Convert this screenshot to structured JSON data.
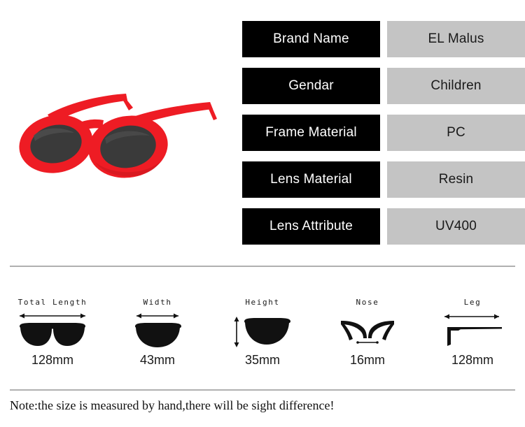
{
  "product": {
    "image_name": "red-oval-sunglasses",
    "frame_color": "#ee1c24",
    "frame_shadow_color": "#b3141a",
    "lens_color": "#3a3a3a",
    "lens_highlight_color": "#4e4e4e"
  },
  "spec_table": {
    "rows": [
      {
        "label": "Brand Name",
        "value": "EL Malus"
      },
      {
        "label": "Gendar",
        "value": "Children"
      },
      {
        "label": "Frame Material",
        "value": "PC"
      },
      {
        "label": "Lens Material",
        "value": "Resin"
      },
      {
        "label": "Lens Attribute",
        "value": "UV400"
      }
    ],
    "label_bg": "#000000",
    "label_color": "#ffffff",
    "value_bg": "#c4c4c4",
    "value_color": "#1a1a1a"
  },
  "measurements": {
    "items": [
      {
        "title": "Total Length",
        "value": "128mm",
        "figure": "full-glasses-horizontal-arrow"
      },
      {
        "title": "Width",
        "value": "43mm",
        "figure": "single-lens-horizontal-arrow"
      },
      {
        "title": "Height",
        "value": "35mm",
        "figure": "single-lens-vertical-arrow"
      },
      {
        "title": "Nose",
        "value": "16mm",
        "figure": "nose-bridge-span"
      },
      {
        "title": "Leg",
        "value": "128mm",
        "figure": "temple-arm-horizontal-arrow"
      }
    ]
  },
  "footer": {
    "note": "Note:the size is measured by hand,there will be sight difference!"
  },
  "dividers": {
    "color": "#b0b0b0"
  }
}
